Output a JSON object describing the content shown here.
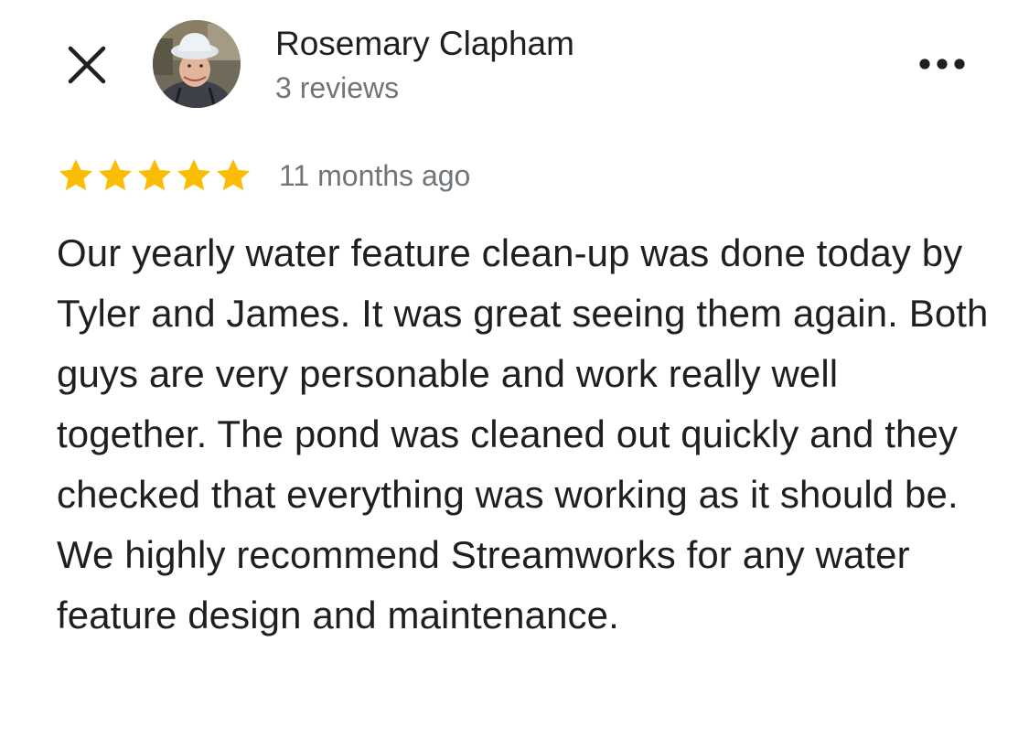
{
  "header": {
    "close_icon": "close-icon",
    "author_name": "Rosemary Clapham",
    "review_count": "3 reviews",
    "more_icon": "more-horizontal-icon"
  },
  "review": {
    "rating": 5,
    "rating_max": 5,
    "star_color": "#fbbc04",
    "timestamp": "11 months ago",
    "text": "Our yearly water feature clean-up was done today by Tyler and James. It was great seeing them again. Both guys are very personable and work really well together. The pond was cleaned out quickly and they checked that everything was working as it should be. We highly recommend Streamworks for any water feature design and maintenance."
  },
  "colors": {
    "text_primary": "#1f1f1f",
    "text_secondary": "#70757a",
    "star": "#fbbc04"
  }
}
